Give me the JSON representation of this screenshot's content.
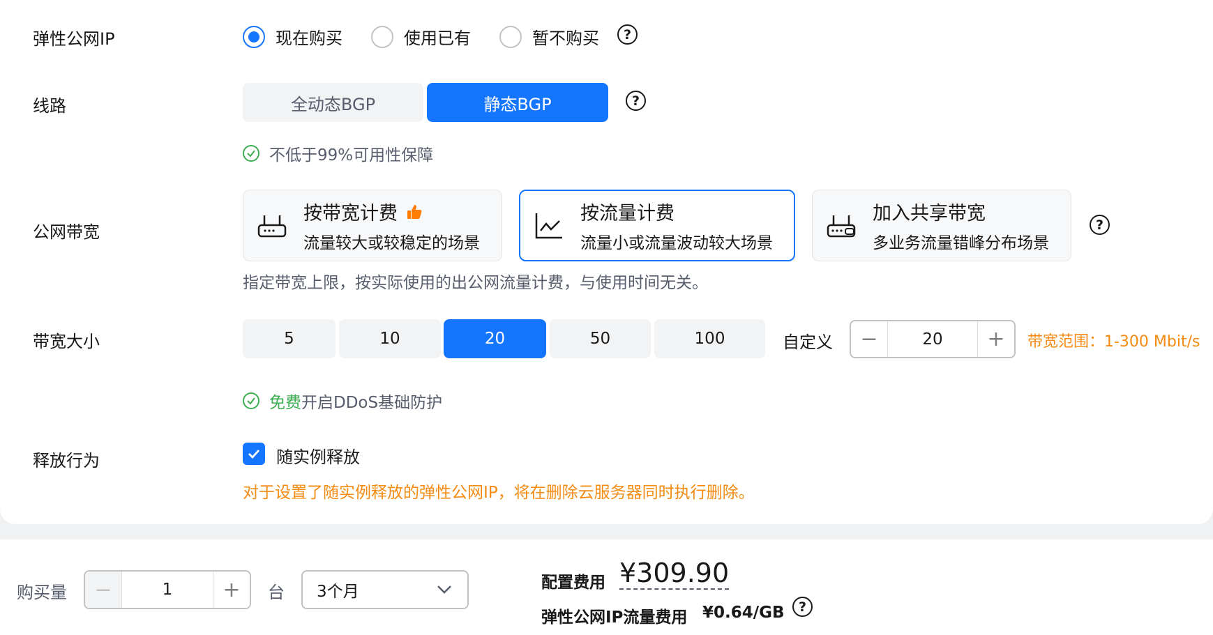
{
  "eip": {
    "label": "弹性公网IP",
    "options": [
      "现在购买",
      "使用已有",
      "暂不购买"
    ],
    "selected_index": 0
  },
  "line": {
    "label": "线路",
    "options": [
      "全动态BGP",
      "静态BGP"
    ],
    "selected_index": 1,
    "guarantee": "不低于99%可用性保障"
  },
  "billing": {
    "label": "公网带宽",
    "cards": [
      {
        "title": "按带宽计费",
        "subtitle": "流量较大或较稳定的场景",
        "icon": "router-icon",
        "recommended": true
      },
      {
        "title": "按流量计费",
        "subtitle": "流量小或流量波动较大场景",
        "icon": "line-chart-icon",
        "recommended": false
      },
      {
        "title": "加入共享带宽",
        "subtitle": "多业务流量错峰分布场景",
        "icon": "shared-router-icon",
        "recommended": false
      }
    ],
    "selected_index": 1,
    "description": "指定带宽上限，按实际使用的出公网流量计费，与使用时间无关。"
  },
  "bandwidth": {
    "label": "带宽大小",
    "options": [
      "5",
      "10",
      "20",
      "50",
      "100"
    ],
    "selected_index": 2,
    "custom_label": "自定义",
    "custom_value": "20",
    "range_text": "带宽范围：1-300 Mbit/s",
    "ddos_free": "免费",
    "ddos_text": "开启DDoS基础防护"
  },
  "release": {
    "label": "释放行为",
    "checkbox_label": "随实例释放",
    "checked": true,
    "warning": "对于设置了随实例释放的弹性公网IP，将在删除云服务器同时执行删除。"
  },
  "footer": {
    "quantity_label": "购买量",
    "quantity_value": "1",
    "unit": "台",
    "duration": "3个月",
    "config_fee_label": "配置费用",
    "config_fee_value": "¥309.90",
    "traffic_fee_label": "弹性公网IP流量费用",
    "traffic_fee_value": "¥0.64/GB"
  },
  "colors": {
    "primary": "#1476ff",
    "success": "#3dae52",
    "warning": "#f48b12",
    "recommend": "#ff7d00"
  }
}
